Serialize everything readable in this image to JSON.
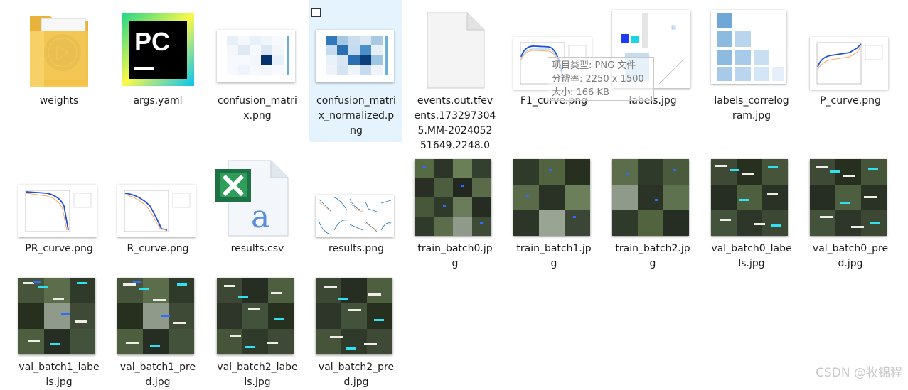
{
  "files": [
    {
      "name": "weights",
      "type": "folder-icon"
    },
    {
      "name": "args.yaml",
      "type": "pycharm-icon"
    },
    {
      "name": "confusion_matrix.png",
      "type": "confusion-matrix-thumbnail"
    },
    {
      "name": "confusion_matrix_normalized.png",
      "type": "confusion-matrix-normalized-thumbnail",
      "selected": true
    },
    {
      "name": "events.out.tfevents.1732973045.MM-2024052 51649.2248.0",
      "type": "blank-file-icon"
    },
    {
      "name": "F1_curve.png",
      "type": "curve-thumbnail"
    },
    {
      "name": "labels.jpg",
      "type": "labels-thumbnail"
    },
    {
      "name": "labels_correlogram.jpg",
      "type": "correlogram-thumbnail"
    },
    {
      "name": "P_curve.png",
      "type": "curve-thumbnail"
    },
    {
      "name": "PR_curve.png",
      "type": "curve-thumbnail"
    },
    {
      "name": "R_curve.png",
      "type": "curve-thumbnail"
    },
    {
      "name": "results.csv",
      "type": "excel-csv-icon"
    },
    {
      "name": "results.png",
      "type": "results-thumbnail"
    },
    {
      "name": "train_batch0.jpg",
      "type": "photo-grid-thumbnail"
    },
    {
      "name": "train_batch1.jpg",
      "type": "photo-grid-thumbnail"
    },
    {
      "name": "train_batch2.jpg",
      "type": "photo-grid-thumbnail"
    },
    {
      "name": "val_batch0_labels.jpg",
      "type": "photo-grid-thumbnail"
    },
    {
      "name": "val_batch0_pred.jpg",
      "type": "photo-grid-thumbnail"
    },
    {
      "name": "val_batch1_labels.jpg",
      "type": "photo-grid-thumbnail"
    },
    {
      "name": "val_batch1_pred.jpg",
      "type": "photo-grid-thumbnail"
    },
    {
      "name": "val_batch2_labels.jpg",
      "type": "photo-grid-thumbnail"
    },
    {
      "name": "val_batch2_pred.jpg",
      "type": "photo-grid-thumbnail"
    }
  ],
  "labels": {
    "weights": "weights",
    "args": "args.yaml",
    "cm1": "confusion_matri",
    "cm2": "x.png",
    "cmn1": "confusion_matri",
    "cmn2": "x_normalized.p",
    "cmn3": "ng",
    "ev1": "events.out.tfev",
    "ev2": "ents.173297304",
    "ev3": "5.MM-2024052",
    "ev4": "51649.2248.0",
    "f1": "F1_curve.png",
    "lab": "labels.jpg",
    "corr1": "labels_correlog",
    "corr2": "ram.jpg",
    "p": "P_curve.png",
    "pr": "PR_curve.png",
    "r": "R_curve.png",
    "csv": "results.csv",
    "res": "results.png",
    "tb0a": "train_batch0.jp",
    "tb0b": "g",
    "tb1a": "train_batch1.jp",
    "tb1b": "g",
    "tb2a": "train_batch2.jp",
    "tb2b": "g",
    "v0la": "val_batch0_labe",
    "v0lb": "ls.jpg",
    "v0pa": "val_batch0_pre",
    "v0pb": "d.jpg",
    "v1la": "val_batch1_labe",
    "v1lb": "ls.jpg",
    "v1pa": "val_batch1_pre",
    "v1pb": "d.jpg",
    "v2la": "val_batch2_labe",
    "v2lb": "ls.jpg",
    "v2pa": "val_batch2_pre",
    "v2pb": "d.jpg"
  },
  "tooltip": {
    "line1": "项目类型: PNG 文件",
    "line2": "分辨率: 2250 x 1500",
    "line3": "大小: 166 KB"
  },
  "watermark": "CSDN @牧锦程",
  "icons": {
    "pycharm_text": "PC"
  },
  "colors": {
    "selection_bg": "#e5f3ff",
    "folder_yellow": "#f3c34a",
    "pycharm_green": "#21d789",
    "excel_green": "#1e7145",
    "cm_blue": "#08306b"
  }
}
